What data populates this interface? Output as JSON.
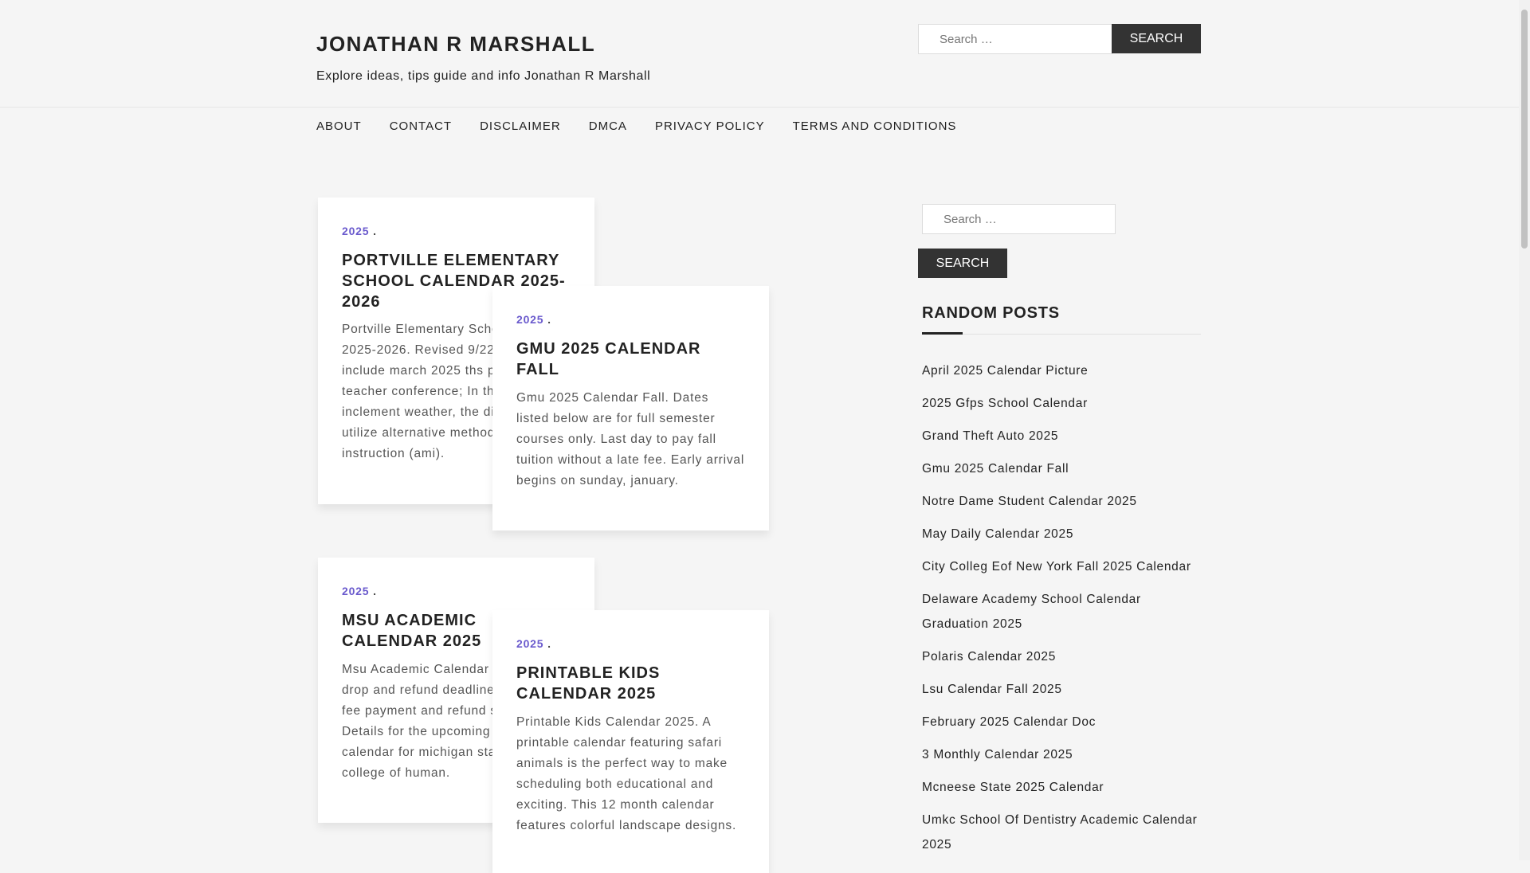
{
  "site": {
    "title": "JONATHAN R MARSHALL",
    "description": "Explore ideas, tips guide and info Jonathan R Marshall"
  },
  "header_search": {
    "placeholder": "Search …",
    "button": "SEARCH"
  },
  "nav": [
    "ABOUT",
    "CONTACT",
    "DISCLAIMER",
    "DMCA",
    "PRIVACY POLICY",
    "TERMS AND CONDITIONS"
  ],
  "posts": [
    {
      "category": "2025",
      "title": "PORTVILLE ELEMENTARY SCHOOL CALENDAR 2025-2026",
      "excerpt": "Portville Elementary School Calendar 2025-2026. Revised 9/22/2025 to include march 2025 ths parent teacher conference; In the event of inclement weather, the district will utilize alternative methods of instruction (ami)."
    },
    {
      "category": "2025",
      "title": "GMU 2025 CALENDAR FALL",
      "excerpt": "Gmu 2025 Calendar Fall. Dates listed below are for full semester courses only. Last day to pay fall tuition without a late fee. Early arrival begins on sunday, january."
    },
    {
      "category": "2025",
      "title": "MSU ACADEMIC CALENDAR 2025",
      "excerpt": "Msu Academic Calendar 2025. Add, drop and refund deadlines, as well as fee payment and refund schedules. Details for the upcoming academic calendar for michigan state university college of human."
    },
    {
      "category": "2025",
      "title": "PRINTABLE KIDS CALENDAR 2025",
      "excerpt": "Printable Kids Calendar 2025. A printable calendar featuring safari animals is the perfect way to make scheduling both educational and exciting. This 12 month calendar features colorful landscape designs."
    }
  ],
  "sidebar": {
    "search": {
      "placeholder": "Search …",
      "button": "SEARCH"
    },
    "random_posts_title": "RANDOM POSTS",
    "random_posts": [
      "April 2025 Calendar Picture",
      "2025 Gfps School Calendar",
      "Grand Theft Auto 2025",
      "Gmu 2025 Calendar Fall",
      "Notre Dame Student Calendar 2025",
      "May Daily Calendar 2025",
      "City Colleg Eof New York Fall 2025 Calendar",
      "Delaware Academy School Calendar Graduation 2025",
      "Polaris Calendar 2025",
      "Lsu Calendar Fall 2025",
      "February 2025 Calendar Doc",
      "3 Monthly Calendar 2025",
      "Mcneese State 2025 Calendar",
      "Umkc School Of Dentistry Academic Calendar 2025"
    ]
  },
  "colors": {
    "accent": "#6a5acd",
    "button": "#333333",
    "background": "#f5f5f5"
  }
}
